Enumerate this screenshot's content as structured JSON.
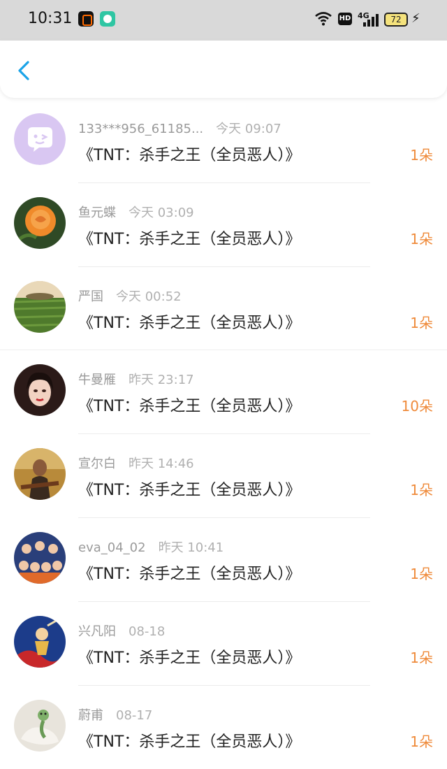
{
  "status_bar": {
    "time": "10:31",
    "network": "4G",
    "hd": "HD",
    "battery": "72"
  },
  "header": {
    "back_icon": "chevron-left-icon"
  },
  "accent_color": "#1aa3e8",
  "quantity_color": "#ef8a3a",
  "entries": [
    {
      "username": "133***956_61185...",
      "time": "今天 09:07",
      "title": "《TNT：杀手之王（全员恶人）》",
      "quantity": "1朵"
    },
    {
      "username": "鱼元蝶",
      "time": "今天 03:09",
      "title": "《TNT：杀手之王（全员恶人）》",
      "quantity": "1朵"
    },
    {
      "username": "严国",
      "time": "今天 00:52",
      "title": "《TNT：杀手之王（全员恶人）》",
      "quantity": "1朵"
    },
    {
      "username": "牛曼雁",
      "time": "昨天 23:17",
      "title": "《TNT：杀手之王（全员恶人）》",
      "quantity": "10朵"
    },
    {
      "username": "宣尔白",
      "time": "昨天 14:46",
      "title": "《TNT：杀手之王（全员恶人）》",
      "quantity": "1朵"
    },
    {
      "username": "eva_04_02",
      "time": "昨天 10:41",
      "title": "《TNT：杀手之王（全员恶人）》",
      "quantity": "1朵"
    },
    {
      "username": "兴凡阳",
      "time": "08-18",
      "title": "《TNT：杀手之王（全员恶人）》",
      "quantity": "1朵"
    },
    {
      "username": "蔚甫",
      "time": "08-17",
      "title": "《TNT：杀手之王（全员恶人）》",
      "quantity": "1朵"
    }
  ]
}
